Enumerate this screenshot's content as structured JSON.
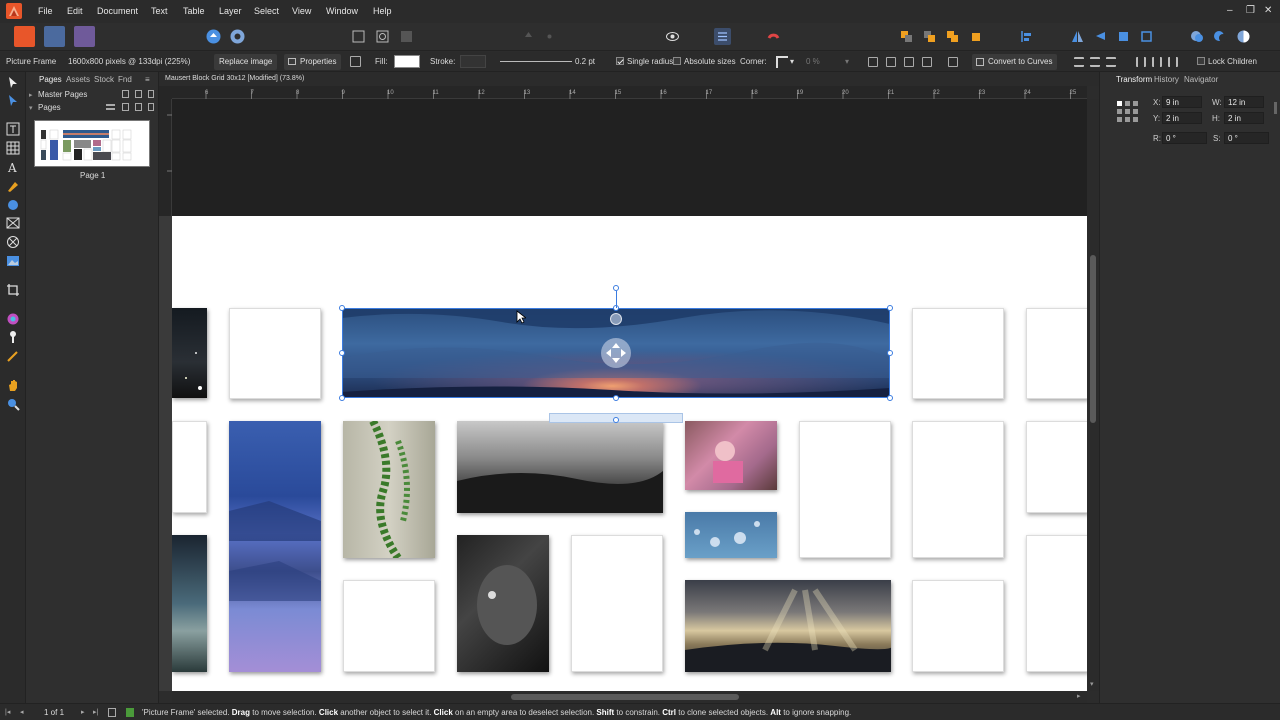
{
  "menu": [
    "File",
    "Edit",
    "Document",
    "Text",
    "Table",
    "Layer",
    "Select",
    "View",
    "Window",
    "Help"
  ],
  "window_controls": [
    "–",
    "❐",
    "✕"
  ],
  "context_bar": {
    "object_type": "Picture Frame",
    "image_info": "1600x800 pixels @ 133dpi (225%)",
    "replace_image": "Replace image",
    "properties": "Properties",
    "fill_label": "Fill:",
    "stroke_label": "Stroke:",
    "stroke_width": "0.2 pt",
    "single_radius": "Single radius",
    "absolute_sizes": "Absolute sizes",
    "corner_label": "Corner:",
    "corner_percent": "0 %",
    "convert_to_curves": "Convert to Curves",
    "lock_children": "Lock Children"
  },
  "pages_panel": {
    "tabs": [
      "Pages",
      "Assets",
      "Stock",
      "Fnd"
    ],
    "master_pages": "Master Pages",
    "pages": "Pages",
    "page_label": "Page 1"
  },
  "document_title": "Mausert Block Grid 30x12 [Modified] (73.8%)",
  "ruler_labels": [
    "6",
    "7",
    "8",
    "9",
    "10",
    "11",
    "12",
    "13",
    "14",
    "15",
    "16",
    "17",
    "18",
    "19",
    "20",
    "21",
    "22",
    "23",
    "24",
    "25"
  ],
  "right_panel": {
    "tabs": [
      "Transform",
      "History",
      "Navigator"
    ],
    "x_label": "X:",
    "x_value": "9 in",
    "w_label": "W:",
    "w_value": "12 in",
    "y_label": "Y:",
    "y_value": "2 in",
    "h_label": "H:",
    "h_value": "2 in",
    "r_label": "R:",
    "r_value": "0 °",
    "s_label": "S:",
    "s_value": "0 °"
  },
  "status": {
    "page_count": "1 of 1",
    "m1": "'Picture Frame' selected. ",
    "b1": "Drag",
    "m2": " to move selection. ",
    "b2": "Click",
    "m3": " another object to select it. ",
    "b3": "Click",
    "m4": " on an empty area to deselect selection. ",
    "b4": "Shift",
    "m5": " to constrain. ",
    "b5": "Ctrl",
    "m6": " to clone selected objects. ",
    "b6": "Alt",
    "m7": " to ignore snapping."
  },
  "colors": {
    "accent": "#3b7ce0",
    "app_orange": "#e8562a",
    "canvas_bg": "#1f1f1f",
    "panel_bg": "#2f2f2f"
  }
}
